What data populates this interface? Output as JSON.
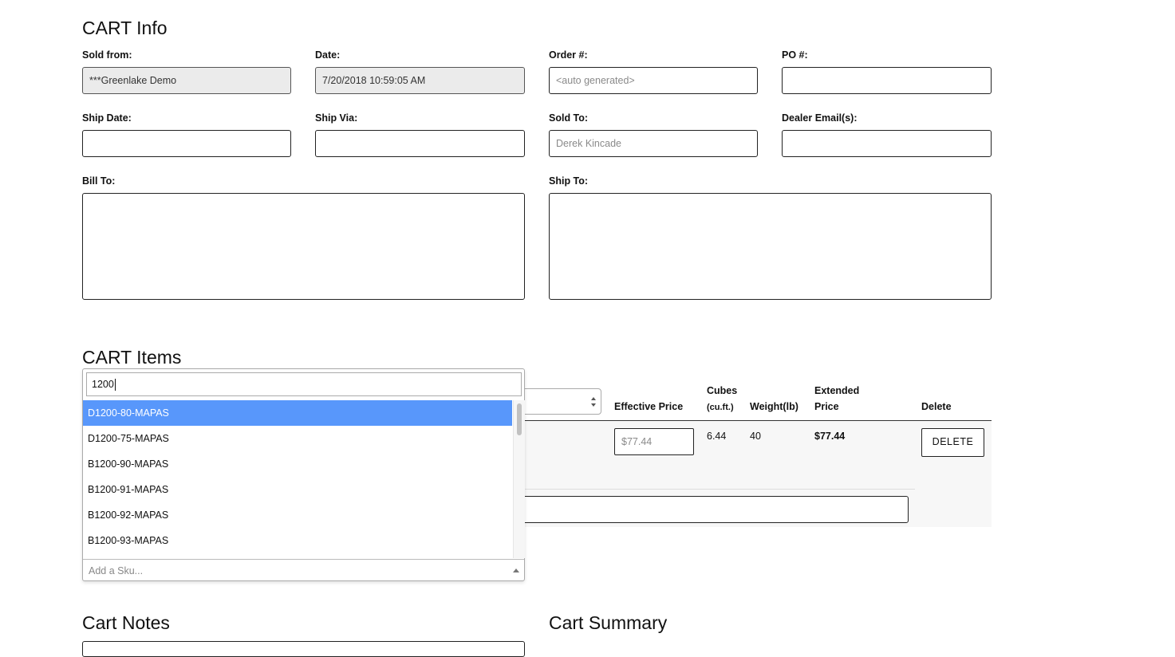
{
  "cart_info": {
    "title": "CART Info",
    "sold_from": {
      "label": "Sold from:",
      "value": "***Greenlake Demo"
    },
    "date": {
      "label": "Date:",
      "value": "7/20/2018 10:59:05 AM"
    },
    "order_no": {
      "label": "Order #:",
      "placeholder": "<auto generated>"
    },
    "po_no": {
      "label": "PO #:",
      "value": ""
    },
    "ship_date": {
      "label": "Ship Date:",
      "value": ""
    },
    "ship_via": {
      "label": "Ship Via:",
      "value": ""
    },
    "sold_to": {
      "label": "Sold To:",
      "placeholder": "Derek Kincade"
    },
    "dealer_emails": {
      "label": "Dealer Email(s):",
      "value": ""
    },
    "bill_to": {
      "label": "Bill To:",
      "value": ""
    },
    "ship_to": {
      "label": "Ship To:",
      "value": ""
    }
  },
  "cart_items": {
    "title": "CART Items",
    "headers": {
      "effective_price": "Effective Price",
      "cubes": "Cubes",
      "cubes_unit": "(cu.ft.)",
      "weight": "Weight(lb)",
      "extended_1": "Extended",
      "extended_2": "Price",
      "delete": "Delete"
    },
    "row": {
      "effective_price_placeholder": "$77.44",
      "cubes": "6.44",
      "weight": "40",
      "extended_price": "$77.44",
      "delete_label": "DELETE"
    }
  },
  "sku_dropdown": {
    "search_value": "1200",
    "options": [
      "D1200-80-MAPAS",
      "D1200-75-MAPAS",
      "B1200-90-MAPAS",
      "B1200-91-MAPAS",
      "B1200-92-MAPAS",
      "B1200-93-MAPAS"
    ],
    "selected_index": 0,
    "placeholder": "Add a Sku..."
  },
  "cart_notes": {
    "title": "Cart Notes"
  },
  "cart_summary": {
    "title": "Cart Summary"
  },
  "colors": {
    "highlight": "#5897fb",
    "readonly_bg": "#ebebeb",
    "row_bg": "#f7f7f7"
  }
}
